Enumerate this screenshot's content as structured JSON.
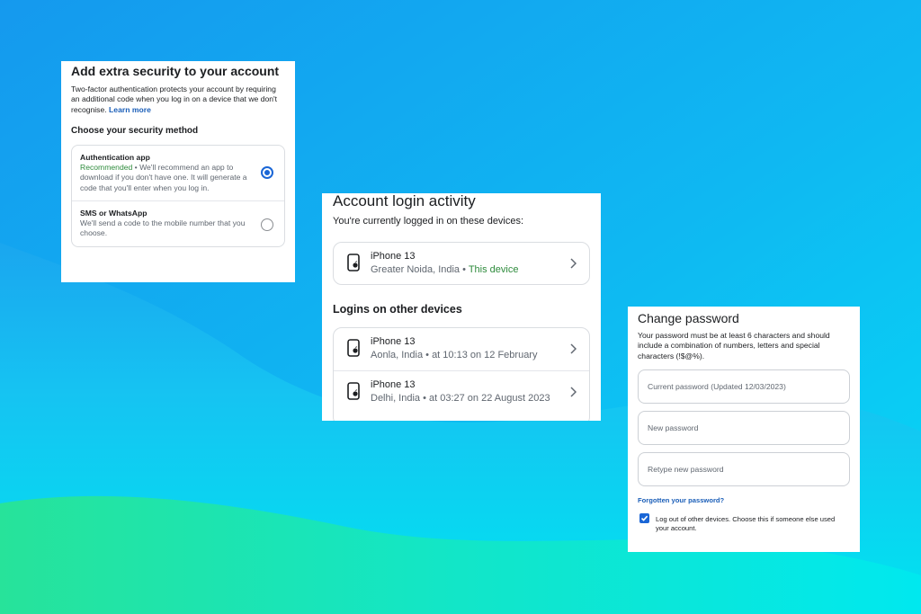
{
  "colors": {
    "background_top": "#1599ee",
    "background_wave": "#00e5f2",
    "background_bottom": "#1fe6a8",
    "link": "#1a5eb8",
    "accent_blue": "#1a66d6",
    "recommended_green": "#2e8b3c"
  },
  "security": {
    "title": "Add extra security to your account",
    "description": "Two-factor authentication protects your account by requiring an additional code when you log in on a device that we don't recognise.",
    "learn_more": "Learn more",
    "choose_label": "Choose your security method",
    "options": [
      {
        "title": "Authentication app",
        "recommended": "Recommended",
        "description": " • We'll recommend an app to download if you don't have one. It will generate a code that you'll enter when you log in.",
        "selected": true
      },
      {
        "title": "SMS or WhatsApp",
        "description": "We'll send a code to the mobile number that you choose.",
        "selected": false
      }
    ]
  },
  "activity": {
    "title": "Account login activity",
    "lead": "You're currently logged in on these devices:",
    "current": {
      "name": "iPhone 13",
      "location": "Greater Noida, India • ",
      "this_device": "This device",
      "icon": "iphone-icon"
    },
    "other_heading": "Logins on other devices",
    "others": [
      {
        "name": "iPhone 13",
        "detail": "Aonla, India • at 10:13 on 12 February",
        "icon": "iphone-icon"
      },
      {
        "name": "iPhone 13",
        "detail": "Delhi, India • at 03:27 on 22 August 2023",
        "icon": "iphone-icon"
      }
    ]
  },
  "password": {
    "title": "Change password",
    "description": "Your password must be at least 6 characters and should include a combination of numbers, letters and special characters (!$@%).",
    "current_placeholder": "Current password (Updated 12/03/2023)",
    "new_placeholder": "New password",
    "retype_placeholder": "Retype new password",
    "forgot": "Forgotten your password?",
    "logout_label": "Log out of other devices. Choose this if someone else used your account.",
    "logout_checked": true
  }
}
